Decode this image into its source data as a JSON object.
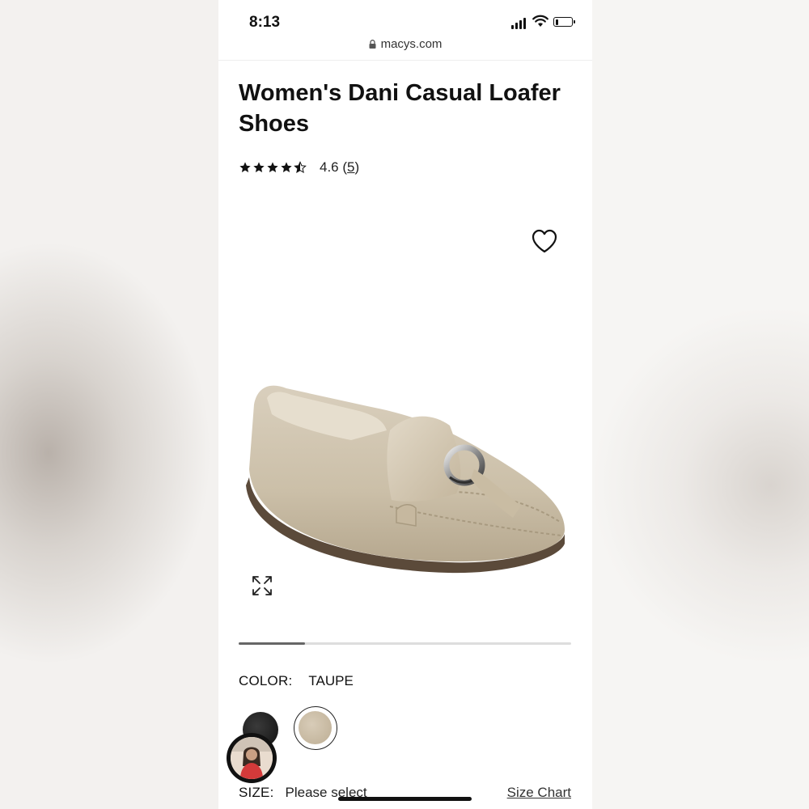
{
  "status_bar": {
    "time": "8:13",
    "battery_level": 0.3
  },
  "browser": {
    "url": "macys.com"
  },
  "product": {
    "title": "Women's Dani Casual Loafer Shoes",
    "rating": {
      "stars": 4.6,
      "value_text": "4.6",
      "count_open": "(",
      "count": "5",
      "count_close": ")"
    },
    "icons": {
      "wishlist": "heart-icon",
      "expand": "expand-icon",
      "lock": "lock-icon",
      "star": "star-icon"
    }
  },
  "carousel": {
    "progress": 0.2
  },
  "color": {
    "label": "COLOR:",
    "selected": "TAUPE",
    "swatches": [
      {
        "name": "black",
        "hex": "#1b1b1b",
        "selected": false
      },
      {
        "name": "taupe",
        "hex": "#c9bba3",
        "selected": true
      }
    ]
  },
  "size": {
    "label": "SIZE:",
    "value": "Please select",
    "chart_link": "Size Chart"
  }
}
